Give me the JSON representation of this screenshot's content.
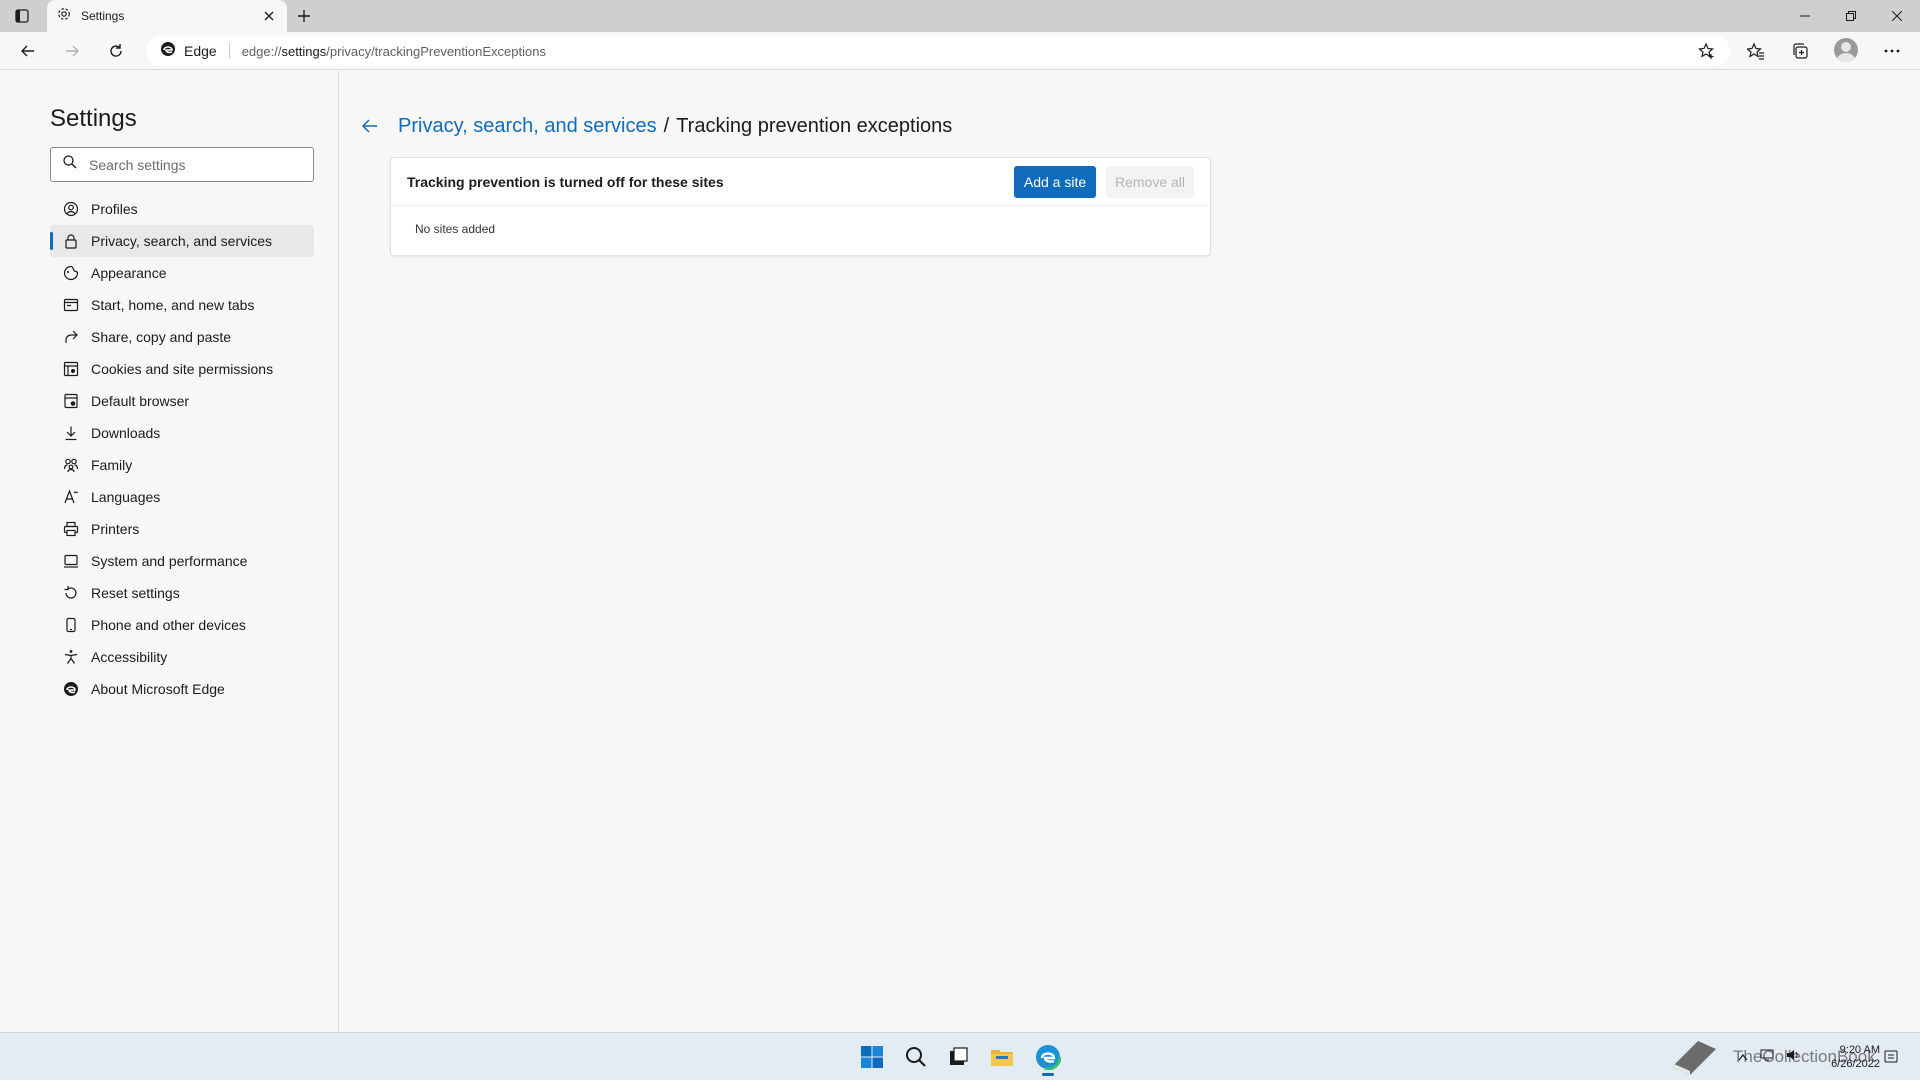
{
  "browser": {
    "tab_title": "Settings",
    "site_label": "Edge",
    "url_prefix": "edge://",
    "url_host": "settings",
    "url_path": "/privacy/trackingPreventionExceptions"
  },
  "sidebar": {
    "title": "Settings",
    "search_placeholder": "Search settings",
    "items": [
      {
        "label": "Profiles",
        "icon": "profile-icon"
      },
      {
        "label": "Privacy, search, and services",
        "icon": "lock-icon",
        "active": true
      },
      {
        "label": "Appearance",
        "icon": "appearance-icon"
      },
      {
        "label": "Start, home, and new tabs",
        "icon": "start-tabs-icon"
      },
      {
        "label": "Share, copy and paste",
        "icon": "share-icon"
      },
      {
        "label": "Cookies and site permissions",
        "icon": "cookies-icon"
      },
      {
        "label": "Default browser",
        "icon": "default-browser-icon"
      },
      {
        "label": "Downloads",
        "icon": "download-icon"
      },
      {
        "label": "Family",
        "icon": "family-icon"
      },
      {
        "label": "Languages",
        "icon": "languages-icon"
      },
      {
        "label": "Printers",
        "icon": "printer-icon"
      },
      {
        "label": "System and performance",
        "icon": "system-icon"
      },
      {
        "label": "Reset settings",
        "icon": "reset-icon"
      },
      {
        "label": "Phone and other devices",
        "icon": "phone-icon"
      },
      {
        "label": "Accessibility",
        "icon": "accessibility-icon"
      },
      {
        "label": "About Microsoft Edge",
        "icon": "edge-logo-icon"
      }
    ]
  },
  "main": {
    "breadcrumb_parent": "Privacy, search, and services",
    "breadcrumb_sep": "/",
    "breadcrumb_current": "Tracking prevention exceptions",
    "card_heading": "Tracking prevention is turned off for these sites",
    "add_site_label": "Add a site",
    "remove_all_label": "Remove all",
    "empty_message": "No sites added"
  },
  "taskbar": {
    "time": "9:20 AM",
    "date": "6/26/2022",
    "watermark": "TheCollectionBook"
  },
  "colors": {
    "accent": "#0f6cbd",
    "taskbar": "#e3ebf3",
    "tabstrip": "#cfcfcf"
  }
}
